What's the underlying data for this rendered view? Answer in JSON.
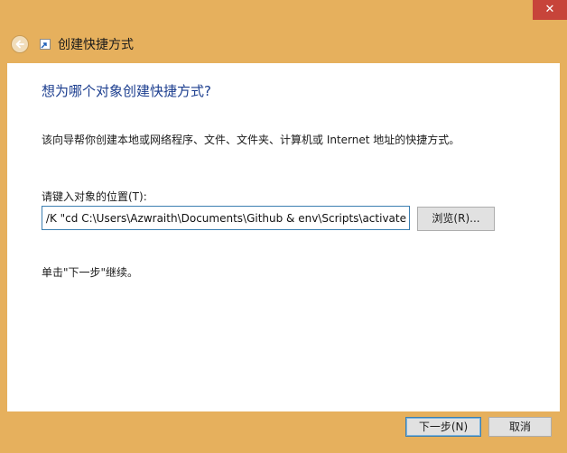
{
  "window": {
    "title": "创建快捷方式",
    "close_glyph": "✕",
    "accent_color": "#e6b05d",
    "close_color": "#c7443a"
  },
  "page": {
    "question": "想为哪个对象创建快捷方式?",
    "description": "该向导帮你创建本地或网络程序、文件、文件夹、计算机或 Internet 地址的快捷方式。",
    "location_label": "请键入对象的位置(T):",
    "location_value": "cmd /K \"cd C:\\Users\\Azwraith\\Documents\\Github & env\\Scripts\\activate\"",
    "browse_label": "浏览(R)...",
    "continue_hint": "单击\"下一步\"继续。"
  },
  "footer": {
    "next_label": "下一步(N)",
    "cancel_label": "取消"
  }
}
